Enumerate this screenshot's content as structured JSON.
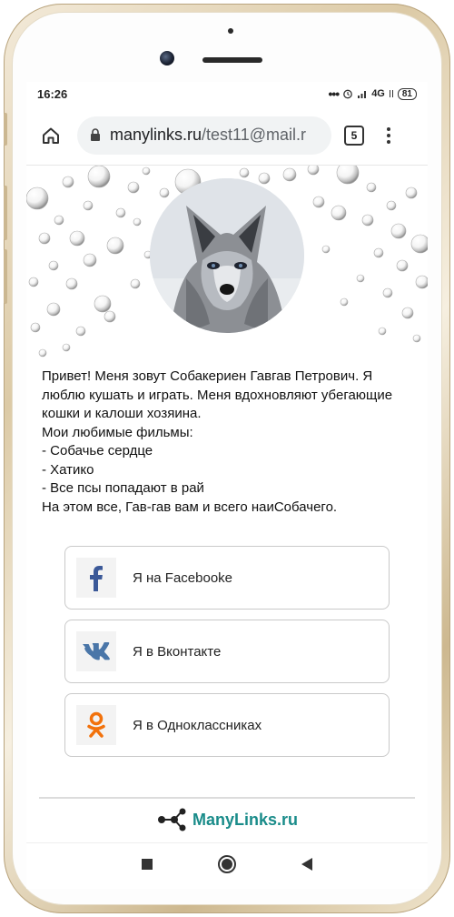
{
  "status": {
    "time": "16:26",
    "network": "4G",
    "battery": "81"
  },
  "browser": {
    "url_host": "manylinks.ru",
    "url_path": "/test11@mail.r",
    "tab_count": "5"
  },
  "profile": {
    "bio": " Привет! Меня зовут Собакериен Гавгав Петрович. Я люблю кушать  и играть.  Меня вдохновляют убегающие кошки и калоши хозяина.\nМои любимые фильмы:\n - Собачье сердце\n - Хатико\n - Все псы попадают в рай\nНа этом все, Гав-гав вам  и всего наиСобачего."
  },
  "links": [
    {
      "label": "Я на Facebooke",
      "icon": "facebook-icon",
      "color": "#3b5998"
    },
    {
      "label": "Я в Вконтакте",
      "icon": "vk-icon",
      "color": "#4a76a8"
    },
    {
      "label": "Я в Одноклассниках",
      "icon": "odnoklassniki-icon",
      "color": "#f2720c"
    }
  ],
  "footer": {
    "brand": "ManyLinks.ru",
    "brand_color": "#1a8c8a"
  }
}
